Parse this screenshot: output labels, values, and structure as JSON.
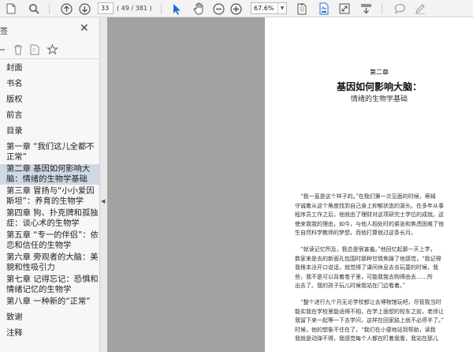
{
  "toolbar": {
    "page_current": "33",
    "page_count": "( 49 / 381 )",
    "zoom": "67.6%"
  },
  "sidebar": {
    "title": "签",
    "items": [
      {
        "lines": [
          "封面"
        ],
        "selected": false
      },
      {
        "lines": [
          "书名"
        ],
        "selected": false
      },
      {
        "lines": [
          "版权"
        ],
        "selected": false
      },
      {
        "lines": [
          "前言"
        ],
        "selected": false
      },
      {
        "lines": [
          "目录"
        ],
        "selected": false
      },
      {
        "lines": [
          "第一章 “我们这儿全都不",
          "正常”"
        ],
        "selected": false
      },
      {
        "lines": [
          "第二章 基因如何影响大",
          "脑：情绪的生物学基础"
        ],
        "selected": true
      },
      {
        "lines": [
          "第三章 冒扬与“小小爱因",
          "斯坦”：养育的生物学"
        ],
        "selected": false
      },
      {
        "lines": [
          "第四章 狗、扑克牌和孤独",
          "症：谈心术的生物学"
        ],
        "selected": false
      },
      {
        "lines": [
          "第五章 “专一的伴侣”：依",
          "恋和信任的生物学"
        ],
        "selected": false
      },
      {
        "lines": [
          "第六章 旁观者的大脑：美",
          "貌和性吸引力"
        ],
        "selected": false
      },
      {
        "lines": [
          "第七章 记得忘记：恐惧和",
          "情绪记忆的生物学"
        ],
        "selected": false
      },
      {
        "lines": [
          "第八章 一种新的“正常”"
        ],
        "selected": false
      },
      {
        "lines": [
          "致谢"
        ],
        "selected": false
      },
      {
        "lines": [
          "注释"
        ],
        "selected": false
      }
    ]
  },
  "document": {
    "chapter_number": "第二章",
    "chapter_title": "基因如何影响大脑：",
    "chapter_subtitle": "情绪的生物学基础",
    "paragraph_lines": [
      "　“我一直是这个样子的。”在我们第一次见面的时候，蒂姆",
      "守诚着从这个角度找到自己身上抑郁状态的源头。在多年从事",
      "程序员工作之后，他就由了理财对这项研究士学位的成就。这",
      "使来我我的理由，如今，与他人相处时的紧张和焦虑困难了他",
      "生自然科学教师的梦想，而他打算就过这条长月。",
      "　“就读记忆所及，我总是很害羞。”他回忆起那一天上学，",
      "数家来是去的新面孔包围时那种甘情焦躁了他感觉，“我记得",
      "我根本没开口说话，就觉得了课间休息去去玩耍的时候，我",
      "些，我不是可以背着卷子里，可能我我去购得由去……所",
      "出去了。我的孩子玩儿时候我站在门边看着。”",
      "　“整个进行九个月无论学校都让去博物馆玩吧，尽管我当时",
      "能实我在学校里能适得不相，在学上面想的校车之前，老师让",
      "我留下来一起等一下去学问，这样在回家路上就不必停半了。”",
      "时候，他的想象不住在了，“我们在小便地站到帮助，读我",
      "我就是动弹不得，我感觉每个人都在盯着我看，我站在那儿"
    ]
  }
}
